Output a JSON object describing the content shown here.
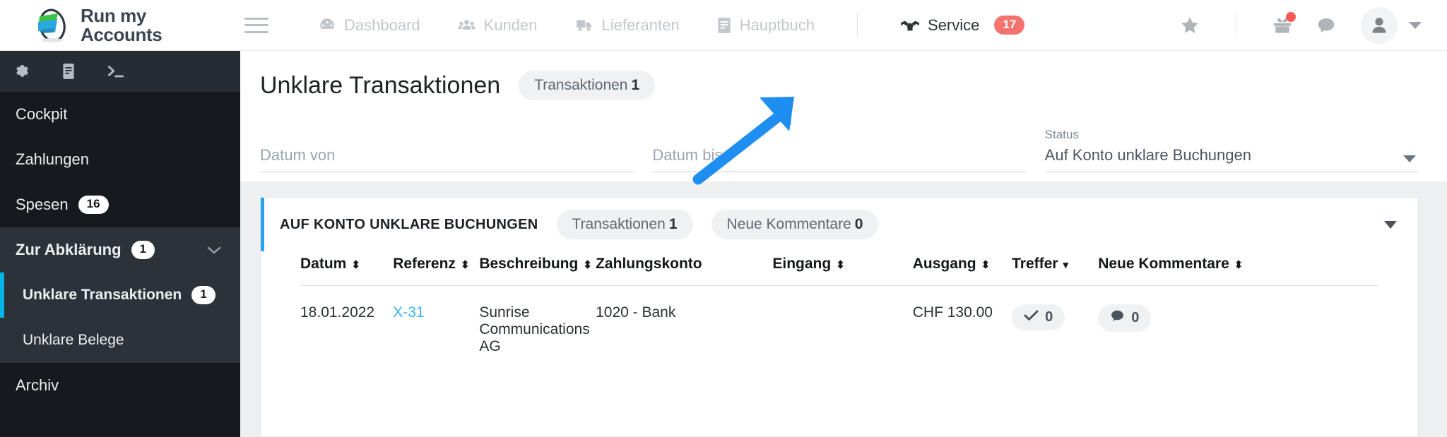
{
  "brand": {
    "name_line1": "Run my",
    "name_line2": "Accounts",
    "accent": "#29a3ec"
  },
  "topnav": {
    "menu_icon": "hamburger-icon",
    "items": [
      {
        "label": "Dashboard",
        "icon": "dashboard-icon",
        "active": false
      },
      {
        "label": "Kunden",
        "icon": "customers-icon",
        "active": false
      },
      {
        "label": "Lieferanten",
        "icon": "truck-icon",
        "active": false
      },
      {
        "label": "Hauptbuch",
        "icon": "book-icon",
        "active": false
      }
    ],
    "service": {
      "label": "Service",
      "icon": "handshake-icon",
      "badge": "17",
      "badge_color": "#f5736f"
    },
    "right_icons": [
      "star-icon",
      "gift-icon",
      "chat-icon",
      "avatar-icon",
      "chevron-down-icon"
    ]
  },
  "sidebar": {
    "tools": [
      "gear-icon",
      "book-icon",
      "terminal-icon"
    ],
    "items": [
      {
        "label": "Cockpit",
        "badge": "",
        "level": "top"
      },
      {
        "label": "Zahlungen",
        "badge": "",
        "level": "top"
      },
      {
        "label": "Spesen",
        "badge": "16",
        "level": "top"
      },
      {
        "label": "Zur Abklärung",
        "badge": "1",
        "level": "group"
      },
      {
        "label": "Unklare Transaktionen",
        "badge": "1",
        "level": "sub-current"
      },
      {
        "label": "Unklare Belege",
        "badge": "",
        "level": "sub"
      },
      {
        "label": "Archiv",
        "badge": "",
        "level": "top"
      }
    ]
  },
  "page": {
    "title": "Unklare Transaktionen",
    "title_pill_label": "Transaktionen",
    "title_pill_count": "1"
  },
  "filters": {
    "date_from_placeholder": "Datum von",
    "date_from_value": "",
    "date_to_placeholder": "Datum bis",
    "date_to_value": "",
    "status_label": "Status",
    "status_value": "Auf Konto unklare Buchungen"
  },
  "card": {
    "title": "AUF KONTO UNKLARE BUCHUNGEN",
    "pill1_label": "Transaktionen",
    "pill1_count": "1",
    "pill2_label": "Neue Kommentare",
    "pill2_count": "0",
    "collapse_icon": "chevron-down-icon"
  },
  "table": {
    "columns": [
      {
        "label": "Datum",
        "sort": "both"
      },
      {
        "label": "Referenz",
        "sort": "both"
      },
      {
        "label": "Beschreibung",
        "sort": "both"
      },
      {
        "label": "Zahlungskonto",
        "sort": "none"
      },
      {
        "label": "Eingang",
        "sort": "both"
      },
      {
        "label": "Ausgang",
        "sort": "both"
      },
      {
        "label": "Treffer",
        "sort": "desc"
      },
      {
        "label": "Neue Kommentare",
        "sort": "both"
      }
    ],
    "rows": [
      {
        "datum": "18.01.2022",
        "referenz": "X-31",
        "beschreibung": "Sunrise Communications AG",
        "zahlungskonto": "1020 - Bank",
        "eingang": "",
        "ausgang": "CHF 130.00",
        "treffer": "0",
        "kommentare": "0"
      }
    ]
  },
  "annotation": {
    "type": "arrow",
    "color": "#1e8ef1",
    "points_to": "status-select"
  }
}
